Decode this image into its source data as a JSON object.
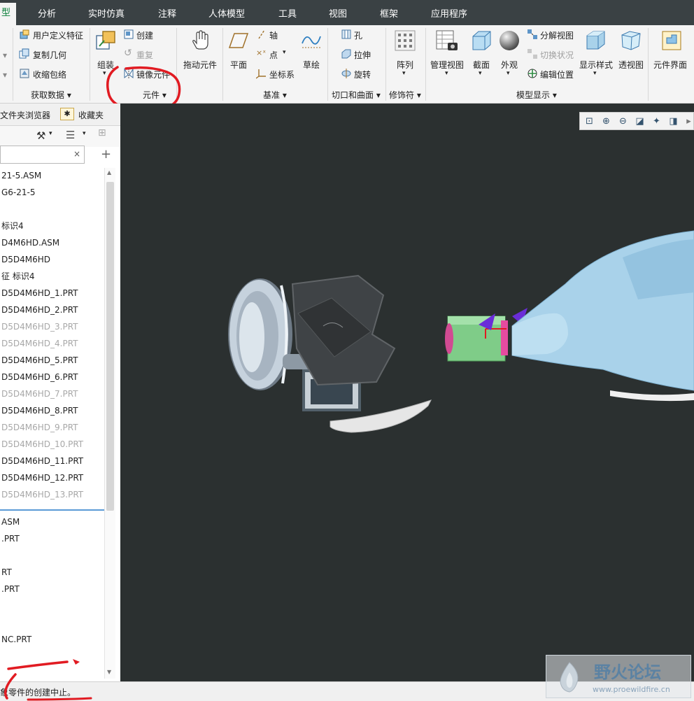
{
  "colors": {
    "accent_green": "#0a7f3a",
    "annotation_red": "#e11b22",
    "graphics_bg": "#2b3030",
    "model_blue": "#a9d2ea"
  },
  "tabs": [
    {
      "label": "型",
      "active": true
    },
    {
      "label": "分析"
    },
    {
      "label": "实时仿真"
    },
    {
      "label": "注释"
    },
    {
      "label": "人体模型"
    },
    {
      "label": "工具"
    },
    {
      "label": "视图"
    },
    {
      "label": "框架"
    },
    {
      "label": "应用程序"
    }
  ],
  "ribbon": {
    "get_data": {
      "udf": "用户定义特征",
      "copy_geom": "复制几何",
      "shrinkwrap": "收缩包络",
      "group": "获取数据"
    },
    "component": {
      "assemble": "组装",
      "create": "创建",
      "repeat": "重复",
      "mirror": "镜像元件",
      "group": "元件",
      "drag": "拖动元件"
    },
    "datum": {
      "plane": "平面",
      "axis": "轴",
      "point": "点",
      "csys": "坐标系",
      "sketch": "草绘",
      "group": "基准"
    },
    "cut_surface": {
      "hole": "孔",
      "extrude": "拉伸",
      "revolve": "旋转",
      "group": "切口和曲面"
    },
    "modifiers": {
      "pattern": "阵列",
      "group": "修饰符"
    },
    "model_display": {
      "manage_views": "管理视图",
      "section": "截面",
      "appearance": "外观",
      "explode": "分解视图",
      "toggle_status": "切换状况",
      "edit_position": "编辑位置",
      "display_style": "显示样式",
      "perspective": "透视图",
      "group": "模型显示"
    },
    "component_interface": "元件界面"
  },
  "navigator": {
    "tabs": [
      "文件夹浏览器",
      "收藏夹"
    ],
    "tree_items": [
      {
        "text": "21-5.ASM",
        "dim": false
      },
      {
        "text": "G6-21-5",
        "dim": false
      },
      {
        "text": "",
        "dim": false
      },
      {
        "text": "标识4",
        "dim": false
      },
      {
        "text": "D4M6HD.ASM",
        "dim": false
      },
      {
        "text": "D5D4M6HD",
        "dim": false
      },
      {
        "text": "征 标识4",
        "dim": false
      },
      {
        "text": "D5D4M6HD_1.PRT",
        "dim": false
      },
      {
        "text": "D5D4M6HD_2.PRT",
        "dim": false
      },
      {
        "text": "D5D4M6HD_3.PRT",
        "dim": true
      },
      {
        "text": "D5D4M6HD_4.PRT",
        "dim": true
      },
      {
        "text": "D5D4M6HD_5.PRT",
        "dim": false
      },
      {
        "text": "D5D4M6HD_6.PRT",
        "dim": false
      },
      {
        "text": "D5D4M6HD_7.PRT",
        "dim": true
      },
      {
        "text": "D5D4M6HD_8.PRT",
        "dim": false
      },
      {
        "text": "D5D4M6HD_9.PRT",
        "dim": true
      },
      {
        "text": "D5D4M6HD_10.PRT",
        "dim": true
      },
      {
        "text": "D5D4M6HD_11.PRT",
        "dim": false
      },
      {
        "text": "D5D4M6HD_12.PRT",
        "dim": false
      },
      {
        "text": "D5D4M6HD_13.PRT",
        "dim": true
      }
    ],
    "tree_items_lower": [
      {
        "text": "ASM"
      },
      {
        "text": ".PRT"
      },
      {
        "text": ""
      },
      {
        "text": "RT"
      },
      {
        "text": ".PRT"
      },
      {
        "text": ""
      },
      {
        "text": ""
      },
      {
        "text": "NC.PRT"
      }
    ]
  },
  "status": {
    "message": "象零件的创建中止。"
  },
  "watermark": {
    "title": "野火论坛",
    "url": "www.proewildfire.cn"
  }
}
